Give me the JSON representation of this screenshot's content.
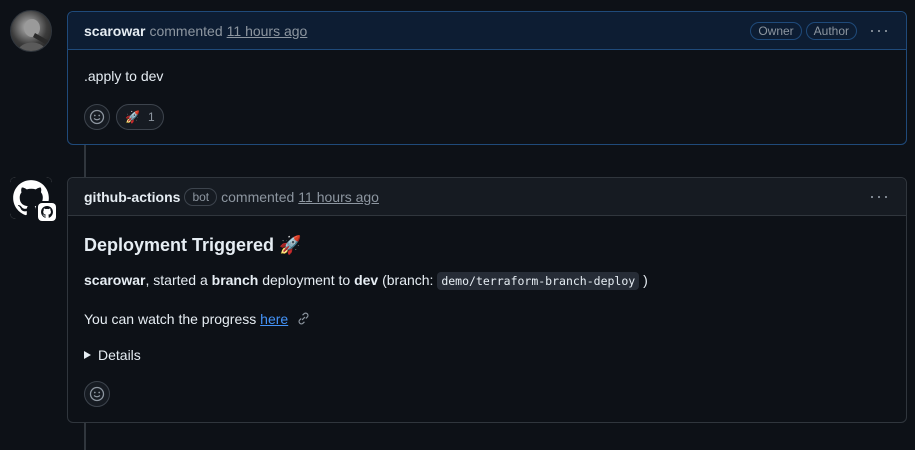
{
  "comment1": {
    "author": "scarowar",
    "action": "commented",
    "timestamp": "11 hours ago",
    "badges": [
      "Owner",
      "Author"
    ],
    "body": ".apply to dev",
    "reactions": [
      {
        "emoji": "🚀",
        "count": "1"
      }
    ]
  },
  "comment2": {
    "author": "github-actions",
    "badge": "bot",
    "action": "commented",
    "timestamp": "11 hours ago",
    "heading": "Deployment Triggered 🚀",
    "line1": {
      "user": "scarowar",
      "text1": ", started a ",
      "type": "branch",
      "text2": " deployment to ",
      "env": "dev",
      "text3": " (branch: ",
      "branch": "demo/terraform-branch-deploy",
      "text4": " )"
    },
    "line2": {
      "text": "You can watch the progress ",
      "link": "here"
    },
    "details_label": "Details"
  },
  "icons": {
    "kebab": "kebab-horizontal-icon",
    "smiley": "smiley-icon",
    "link": "link-icon",
    "disclosure": "triangle-right-icon"
  },
  "colors": {
    "accent": "#4493f8",
    "background": "#0d1117",
    "border": "#30363d"
  }
}
